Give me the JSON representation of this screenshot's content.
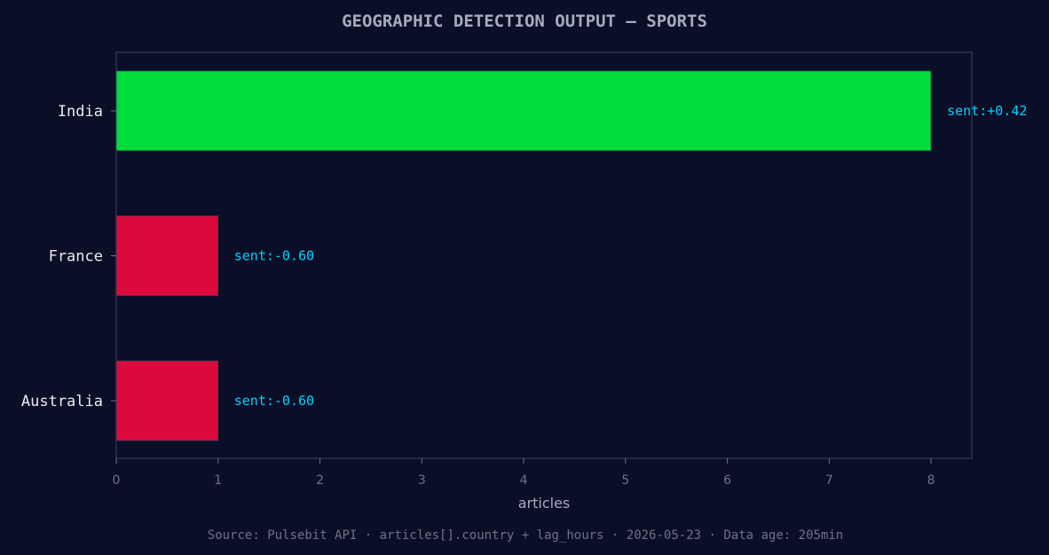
{
  "chart_data": {
    "type": "bar",
    "orientation": "horizontal",
    "title": "GEOGRAPHIC DETECTION OUTPUT — SPORTS",
    "xlabel": "articles",
    "ylabel": "",
    "categories": [
      "India",
      "France",
      "Australia"
    ],
    "values": [
      8,
      1,
      1
    ],
    "annotations": [
      "sent:+0.42",
      "sent:-0.60",
      "sent:-0.60"
    ],
    "bar_colors": [
      "#00dc3c",
      "#dc0a3c",
      "#dc0a3c"
    ],
    "xlim": [
      0,
      8.4
    ],
    "xticks": [
      0,
      1,
      2,
      3,
      4,
      5,
      6,
      7,
      8
    ],
    "grid": false,
    "legend": "none"
  },
  "footer": "Source: Pulsebit API · articles[].country + lag_hours · 2026-05-23 · Data age: 205min",
  "colors": {
    "background": "#0a0e27",
    "plot_frame": "#2c3150",
    "annotation": "#00d4ff",
    "tick": "#6e7385"
  }
}
